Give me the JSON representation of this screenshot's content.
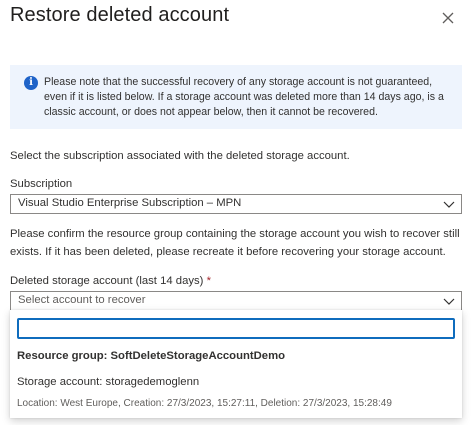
{
  "dialog": {
    "title": "Restore deleted account"
  },
  "info": {
    "message": "Please note that the successful recovery of any storage account is not guaranteed, even if it is listed below. If a storage account was deleted more than 14 days ago, is a classic account, or does not appear below, then it cannot be recovered."
  },
  "subscription": {
    "intro": "Select the subscription associated with the deleted storage account.",
    "label": "Subscription",
    "value": "Visual Studio Enterprise Subscription – MPN"
  },
  "resource_group": {
    "intro": "Please confirm the resource group containing the storage account you wish to recover still exists. If it has been deleted, please recreate it before recovering your storage account."
  },
  "deleted_account": {
    "label": "Deleted storage account (last 14 days)",
    "required_mark": "*",
    "placeholder": "Select account to recover",
    "filter_value": "",
    "group_header": "Resource group: SoftDeleteStorageAccountDemo",
    "options": [
      {
        "name": "Storage account: storagedemoglenn",
        "details": "Location: West Europe, Creation: 27/3/2023, 15:27:11, Deletion: 27/3/2023, 15:28:49"
      }
    ]
  },
  "icons": {
    "close": "close-icon",
    "info": "info-icon",
    "chevron": "chevron-down-icon"
  },
  "colors": {
    "accent": "#0f6cbd",
    "info_background": "#eef4fd",
    "info_icon": "#1f63c8",
    "required": "#a4262c"
  }
}
